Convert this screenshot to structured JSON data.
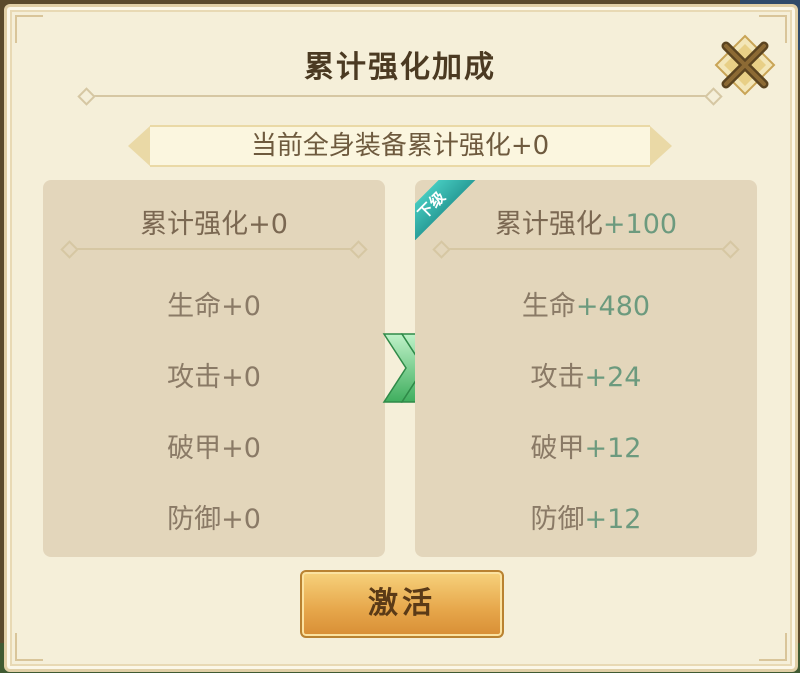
{
  "dialog": {
    "title": "累计强化加成",
    "banner": "当前全身装备累计强化+0",
    "activate_label": "激活"
  },
  "current": {
    "title": "累计强化+0",
    "stats": [
      {
        "name": "生命",
        "value": "+0"
      },
      {
        "name": "攻击",
        "value": "+0"
      },
      {
        "name": "破甲",
        "value": "+0"
      },
      {
        "name": "防御",
        "value": "+0"
      }
    ]
  },
  "next": {
    "badge": "下级",
    "title_name": "累计强化",
    "title_value": "+100",
    "stats": [
      {
        "name": "生命",
        "value": "+480"
      },
      {
        "name": "攻击",
        "value": "+24"
      },
      {
        "name": "破甲",
        "value": "+12"
      },
      {
        "name": "防御",
        "value": "+12"
      }
    ]
  },
  "icons": {
    "close": "close-x-icon",
    "arrow": "double-chevron-right-icon"
  },
  "colors": {
    "accent_green": "#6c9a7e",
    "badge_teal": "#2fb0a8",
    "button_gold": "#e6a64a"
  }
}
